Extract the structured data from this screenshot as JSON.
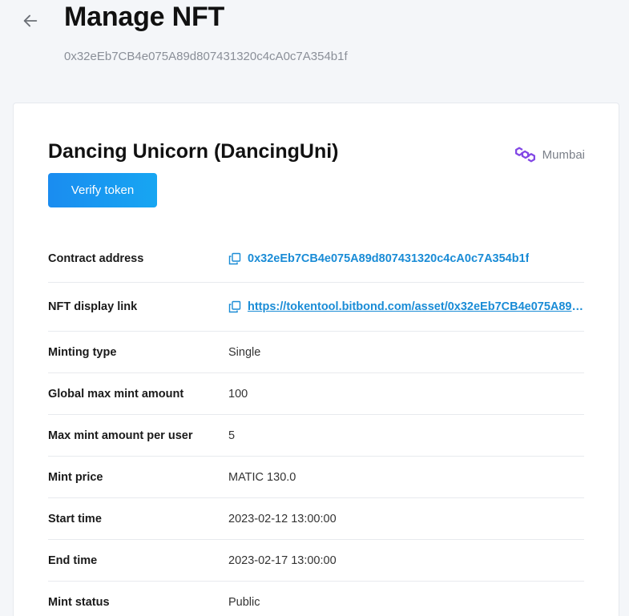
{
  "header": {
    "title": "Manage NFT",
    "subtitle": "0x32eEb7CB4e075A89d807431320c4cA0c7A354b1f"
  },
  "token": {
    "name": "Dancing Unicorn (DancingUni)",
    "network": "Mumbai",
    "network_icon": "polygon-icon",
    "verify_label": "Verify token"
  },
  "details": {
    "contract_address": {
      "label": "Contract address",
      "value": "0x32eEb7CB4e075A89d807431320c4cA0c7A354b1f"
    },
    "display_link": {
      "label": "NFT display link",
      "value": "https://tokentool.bitbond.com/asset/0x32eEb7CB4e075A89d807431320c4cA0c7A354b1f"
    },
    "minting_type": {
      "label": "Minting type",
      "value": "Single"
    },
    "global_max": {
      "label": "Global max mint amount",
      "value": "100"
    },
    "max_per_user": {
      "label": "Max mint amount per user",
      "value": "5"
    },
    "mint_price": {
      "label": "Mint price",
      "value": "MATIC 130.0"
    },
    "start_time": {
      "label": "Start time",
      "value": "2023-02-12 13:00:00"
    },
    "end_time": {
      "label": "End time",
      "value": "2023-02-17 13:00:00"
    },
    "mint_status": {
      "label": "Mint status",
      "value": "Public"
    }
  },
  "colors": {
    "accent": "#1a8cf0",
    "link": "#1a8cd6",
    "polygon": "#8247e5",
    "background": "#f4f6f9"
  }
}
